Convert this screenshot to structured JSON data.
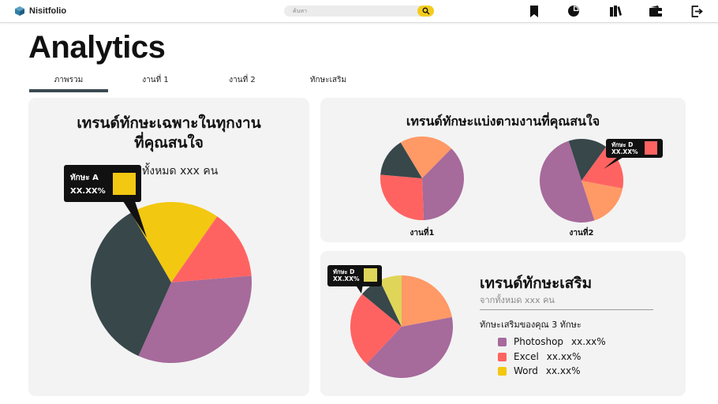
{
  "app": {
    "name": "Nisitfolio"
  },
  "search": {
    "placeholder": "ค้นหา"
  },
  "nav_icons": [
    "bookmark-icon",
    "chart-pie-icon",
    "books-icon",
    "wallet-icon",
    "logout-icon"
  ],
  "page": {
    "title": "Analytics"
  },
  "tabs": [
    {
      "label": "ภาพรวม",
      "active": true
    },
    {
      "label": "งานที่ 1",
      "active": false
    },
    {
      "label": "งานที่ 2",
      "active": false
    },
    {
      "label": "ทักษะเสริม",
      "active": false
    }
  ],
  "colors": {
    "purple": "#a66a9b",
    "red": "#ff6361",
    "dark": "#37474a",
    "yellow": "#f2c811",
    "orange": "#ff9966",
    "lime": "#dfd558",
    "accent": "#f4cc1e"
  },
  "card_all": {
    "title_line1": "เทรนด์ทักษะเฉพาะในทุกงาน",
    "title_line2": "ที่คุณสนใจ",
    "subtitle": "ทั้งหมด xxx คน",
    "tooltip": {
      "label": "ทักษะ A",
      "value": "XX.XX%"
    }
  },
  "card_jobs": {
    "title": "เทรนด์ทักษะแบ่งตามงานที่คุณสนใจ",
    "job1_label": "งานที่1",
    "job2_label": "งานที่2",
    "tooltip": {
      "label": "ทักษะ D",
      "value": "XX.XX%"
    }
  },
  "card_extra": {
    "title": "เทรนด์ทักษะเสริม",
    "subtitle": "จากทั้งหมด xxx คน",
    "yours": "ทักษะเสริมของคุณ 3 ทักษะ",
    "tooltip": {
      "label": "ทักษะ D",
      "value": "XX.XX%"
    },
    "legend": [
      {
        "name": "Photoshop",
        "value": "xx.xx%",
        "color": "#a66a9b"
      },
      {
        "name": "Excel",
        "value": "xx.xx%",
        "color": "#ff6361"
      },
      {
        "name": "Word",
        "value": "xx.xx%",
        "color": "#f2c811"
      }
    ]
  },
  "chart_data": [
    {
      "type": "pie",
      "series": [
        {
          "color": "#f2c811",
          "value": 18
        },
        {
          "color": "#ff6361",
          "value": 14
        },
        {
          "color": "#a66a9b",
          "value": 33
        },
        {
          "color": "#37474a",
          "value": 35
        }
      ]
    },
    {
      "type": "pie",
      "series": [
        {
          "color": "#ff9966",
          "value": 21
        },
        {
          "color": "#a66a9b",
          "value": 37
        },
        {
          "color": "#ff6361",
          "value": 27
        },
        {
          "color": "#37474a",
          "value": 15
        }
      ]
    },
    {
      "type": "pie",
      "series": [
        {
          "color": "#37474a",
          "value": 15
        },
        {
          "color": "#ff6361",
          "value": 18
        },
        {
          "color": "#ff9966",
          "value": 17
        },
        {
          "color": "#a66a9b",
          "value": 50
        }
      ]
    },
    {
      "type": "pie",
      "series": [
        {
          "color": "#ff9966",
          "value": 22
        },
        {
          "color": "#a66a9b",
          "value": 40
        },
        {
          "color": "#ff6361",
          "value": 24
        },
        {
          "color": "#37474a",
          "value": 7
        },
        {
          "color": "#dfd558",
          "value": 7
        }
      ]
    }
  ]
}
